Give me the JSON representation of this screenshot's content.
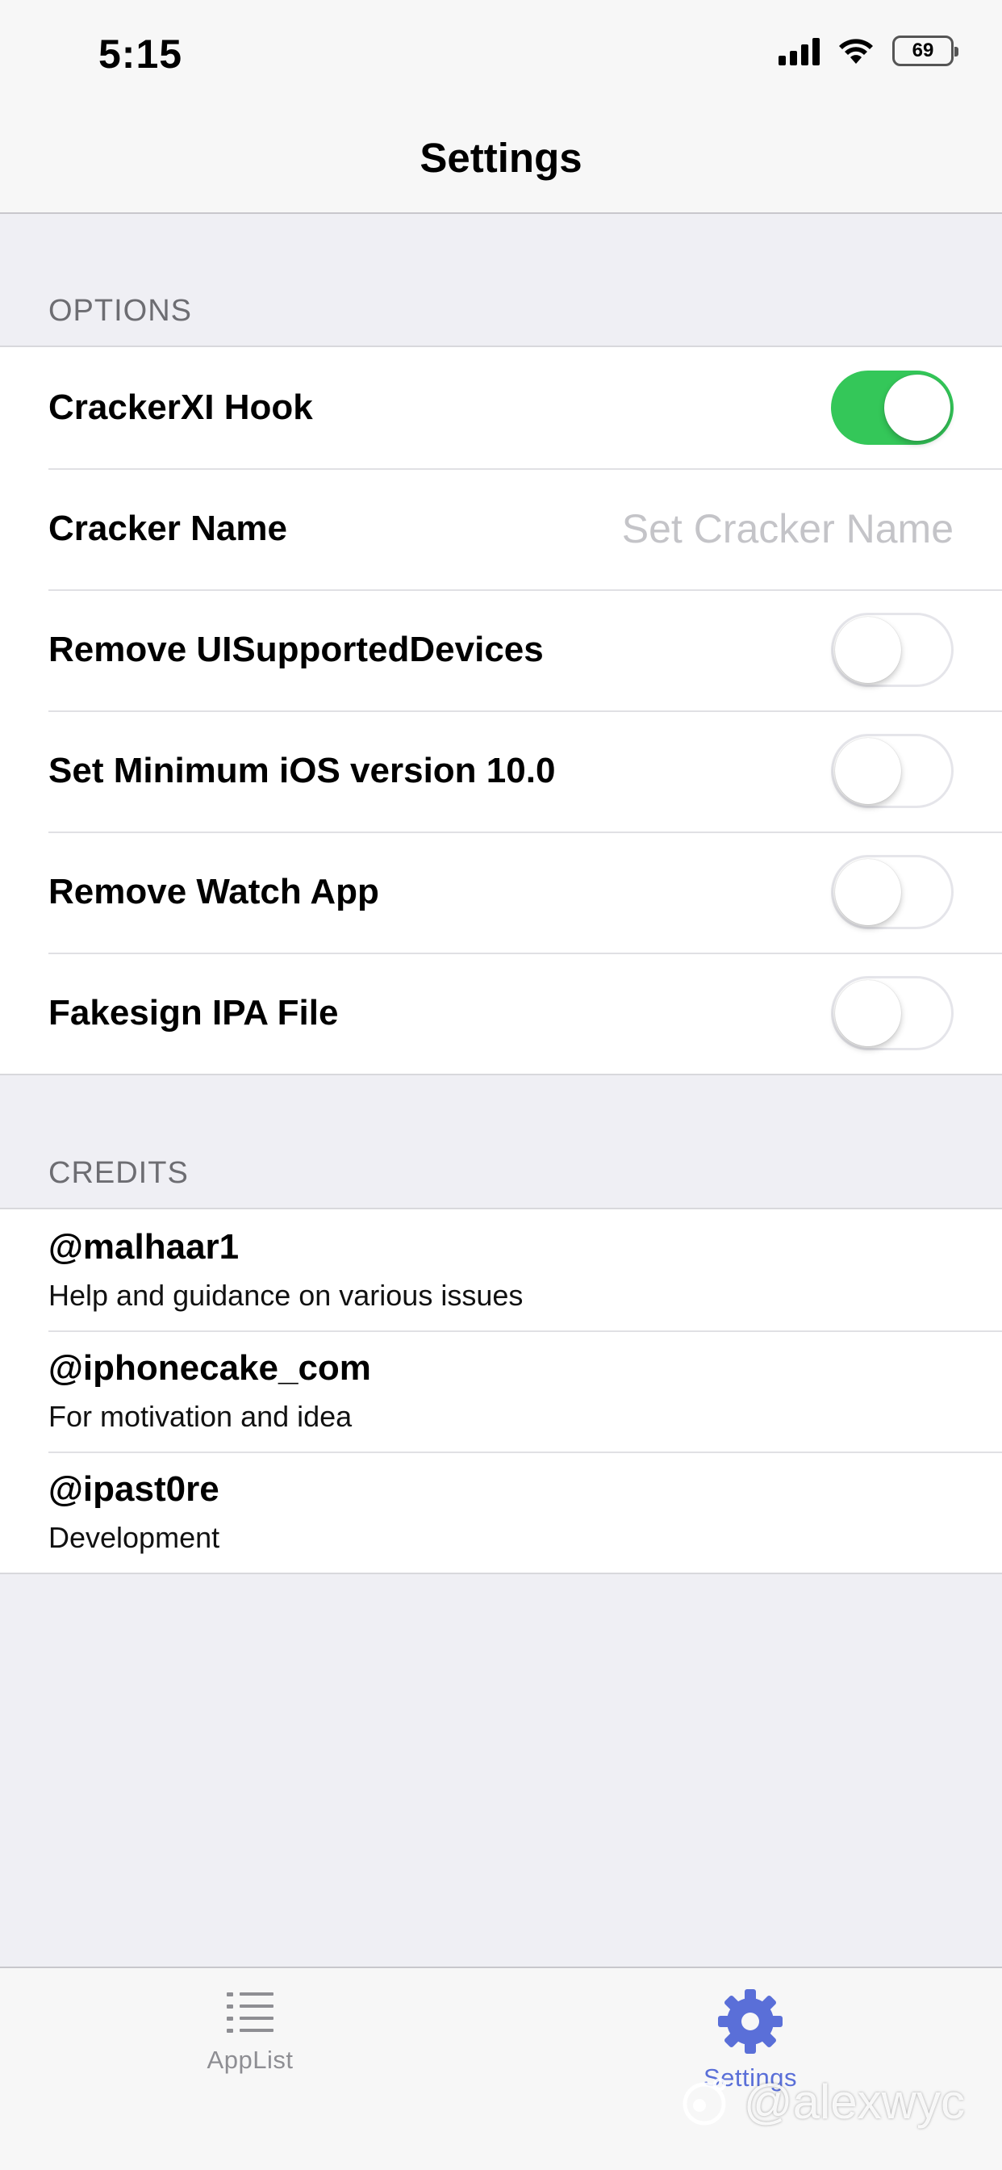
{
  "status_bar": {
    "time": "5:15",
    "battery": "69"
  },
  "nav": {
    "title": "Settings"
  },
  "options": {
    "header": "OPTIONS",
    "rows": [
      {
        "label": "CrackerXI Hook",
        "type": "toggle",
        "on": true
      },
      {
        "label": "Cracker Name",
        "type": "text",
        "placeholder": "Set Cracker Name"
      },
      {
        "label": "Remove UISupportedDevices",
        "type": "toggle",
        "on": false
      },
      {
        "label": "Set Minimum iOS version 10.0",
        "type": "toggle",
        "on": false
      },
      {
        "label": "Remove Watch App",
        "type": "toggle",
        "on": false
      },
      {
        "label": "Fakesign IPA File",
        "type": "toggle",
        "on": false
      }
    ]
  },
  "credits": {
    "header": "CREDITS",
    "items": [
      {
        "handle": "@malhaar1",
        "desc": "Help and guidance on various issues"
      },
      {
        "handle": "@iphonecake_com",
        "desc": "For motivation and idea"
      },
      {
        "handle": "@ipast0re",
        "desc": "Development"
      }
    ]
  },
  "tab_bar": {
    "items": [
      {
        "label": "AppList",
        "icon": "list-icon",
        "active": false
      },
      {
        "label": "Settings",
        "icon": "gear-icon",
        "active": true
      }
    ]
  },
  "watermark": {
    "text": "@alexwyc"
  },
  "colors": {
    "toggle_on": "#34c759",
    "tab_active": "#5a6fd8",
    "tab_inactive": "#8e8e93"
  }
}
